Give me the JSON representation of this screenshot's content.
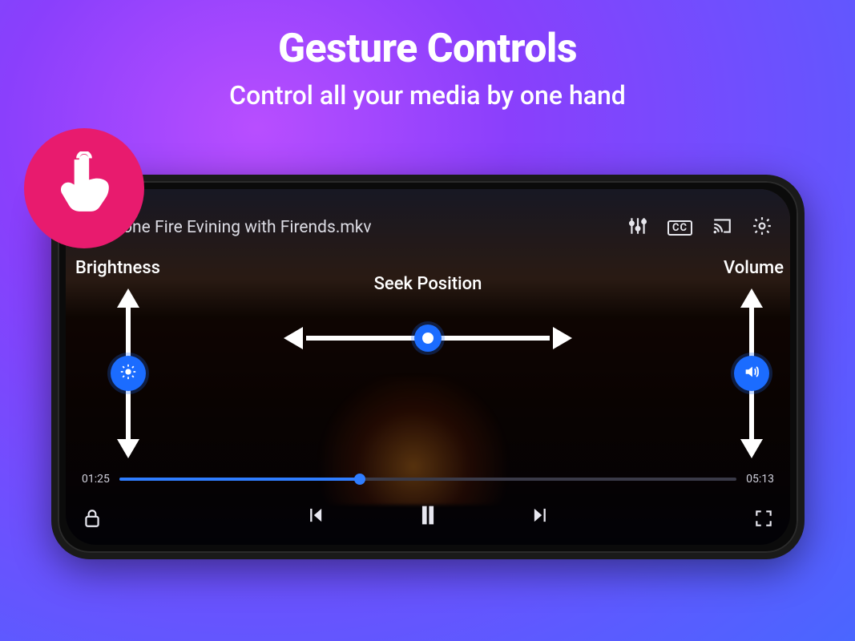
{
  "marketing": {
    "title": "Gesture Controls",
    "subtitle": "Control all your media by one hand"
  },
  "player": {
    "video_title": "Bone Fire Evining with Firends.mkv",
    "top_actions": {
      "equalizer": "equalizer",
      "cc_label": "CC",
      "cast": "cast",
      "settings": "settings"
    },
    "gesture_labels": {
      "brightness": "Brightness",
      "volume": "Volume",
      "seek": "Seek Position"
    },
    "time": {
      "elapsed": "01:25",
      "total": "05:13"
    },
    "controls": {
      "lock": "lock",
      "previous": "previous",
      "play_pause": "pause",
      "next": "next",
      "fullscreen": "fullscreen"
    }
  }
}
